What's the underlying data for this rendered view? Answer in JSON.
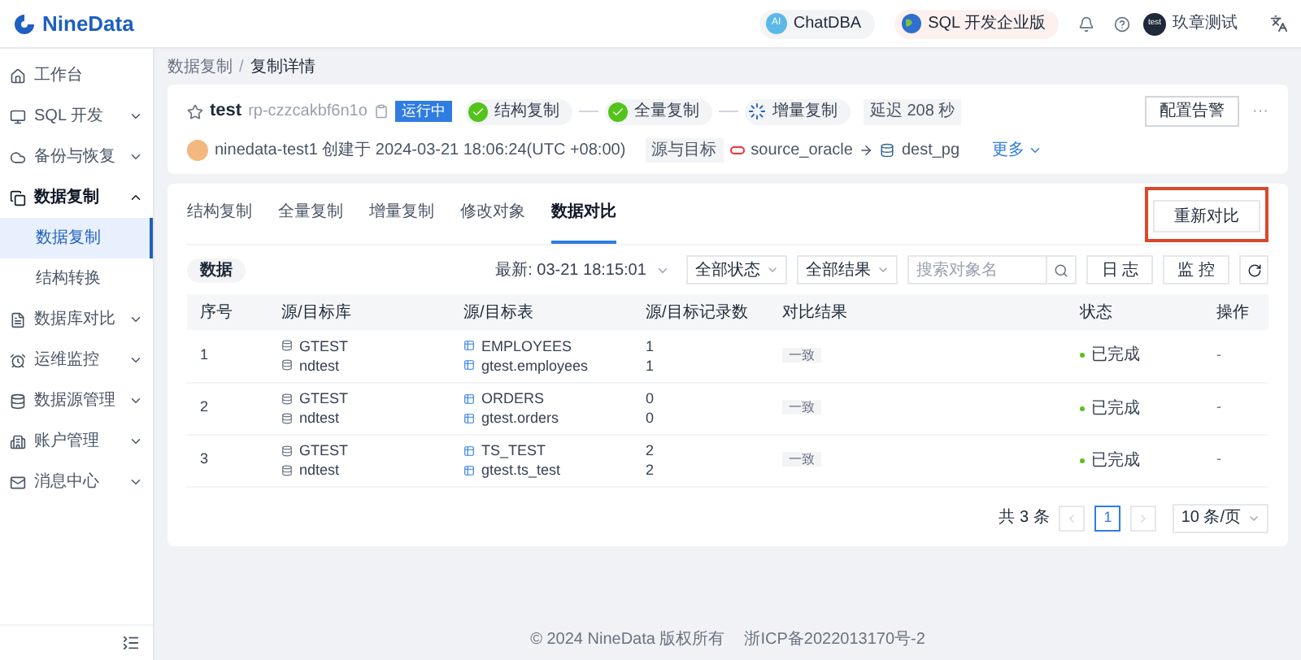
{
  "header": {
    "logo": "NineData",
    "chatdba": {
      "badge": "AI",
      "label": "ChatDBA"
    },
    "edition": "SQL 开发企业版",
    "user": {
      "avatar": "test",
      "name": "玖章测试"
    }
  },
  "sidebar": {
    "items": [
      {
        "label": "工作台",
        "has_children": false,
        "expanded": false
      },
      {
        "label": "SQL 开发",
        "has_children": true,
        "expanded": false
      },
      {
        "label": "备份与恢复",
        "has_children": true,
        "expanded": false
      },
      {
        "label": "数据复制",
        "has_children": true,
        "expanded": true,
        "children": [
          {
            "label": "数据复制",
            "selected": true
          },
          {
            "label": "结构转换",
            "selected": false
          }
        ]
      },
      {
        "label": "数据库对比",
        "has_children": true,
        "expanded": false
      },
      {
        "label": "运维监控",
        "has_children": true,
        "expanded": false
      },
      {
        "label": "数据源管理",
        "has_children": true,
        "expanded": false
      },
      {
        "label": "账户管理",
        "has_children": true,
        "expanded": false
      },
      {
        "label": "消息中心",
        "has_children": true,
        "expanded": false
      }
    ]
  },
  "breadcrumb": {
    "items": [
      "数据复制",
      "复制详情"
    ],
    "separator": "/"
  },
  "task": {
    "name": "test",
    "id": "rp-czzcakbf6n1o",
    "status": "运行中",
    "steps": [
      {
        "label": "结构复制",
        "kind": "done"
      },
      {
        "label": "全量复制",
        "kind": "done"
      },
      {
        "label": "增量复制",
        "kind": "running"
      }
    ],
    "delay": "延迟 208 秒",
    "creator": "ninedata-test1 创建于 2024-03-21 18:06:24(UTC +08:00)",
    "route_label": "源与目标",
    "source": "source_oracle",
    "target": "dest_pg",
    "more": "更多",
    "alarm_button": "配置告警",
    "more_menu": "···"
  },
  "tabs": [
    {
      "label": "结构复制",
      "selected": false
    },
    {
      "label": "全量复制",
      "selected": false
    },
    {
      "label": "增量复制",
      "selected": false
    },
    {
      "label": "修改对象",
      "selected": false
    },
    {
      "label": "数据对比",
      "selected": true
    }
  ],
  "recompare_button": "重新对比",
  "toolbar": {
    "chip": "数据",
    "latest": "最新: 03-21 18:15:01",
    "status_filter": "全部状态",
    "result_filter": "全部结果",
    "search": {
      "placeholder": "搜索对象名"
    },
    "log_button": "日 志",
    "monitor_button": "监 控"
  },
  "table": {
    "columns": [
      "序号",
      "源/目标库",
      "源/目标表",
      "源/目标记录数",
      "对比结果",
      "状态",
      "操作"
    ],
    "rows": [
      {
        "index": "1",
        "src_db": "GTEST",
        "dst_db": "ndtest",
        "src_table": "EMPLOYEES",
        "dst_table": "gtest.employees",
        "src_count": "1",
        "dst_count": "1",
        "result": "一致",
        "status": "已完成",
        "action": "-"
      },
      {
        "index": "2",
        "src_db": "GTEST",
        "dst_db": "ndtest",
        "src_table": "ORDERS",
        "dst_table": "gtest.orders",
        "src_count": "0",
        "dst_count": "0",
        "result": "一致",
        "status": "已完成",
        "action": "-"
      },
      {
        "index": "3",
        "src_db": "GTEST",
        "dst_db": "ndtest",
        "src_table": "TS_TEST",
        "dst_table": "gtest.ts_test",
        "src_count": "2",
        "dst_count": "2",
        "result": "一致",
        "status": "已完成",
        "action": "-"
      }
    ]
  },
  "pagination": {
    "total": "共 3 条",
    "pages": [
      {
        "label": "1",
        "selected": true
      }
    ],
    "page_size": "10 条/页"
  },
  "footer": {
    "copyright": "© 2024 NineData 版权所有",
    "icp": "浙ICP备2022013170号-2"
  }
}
